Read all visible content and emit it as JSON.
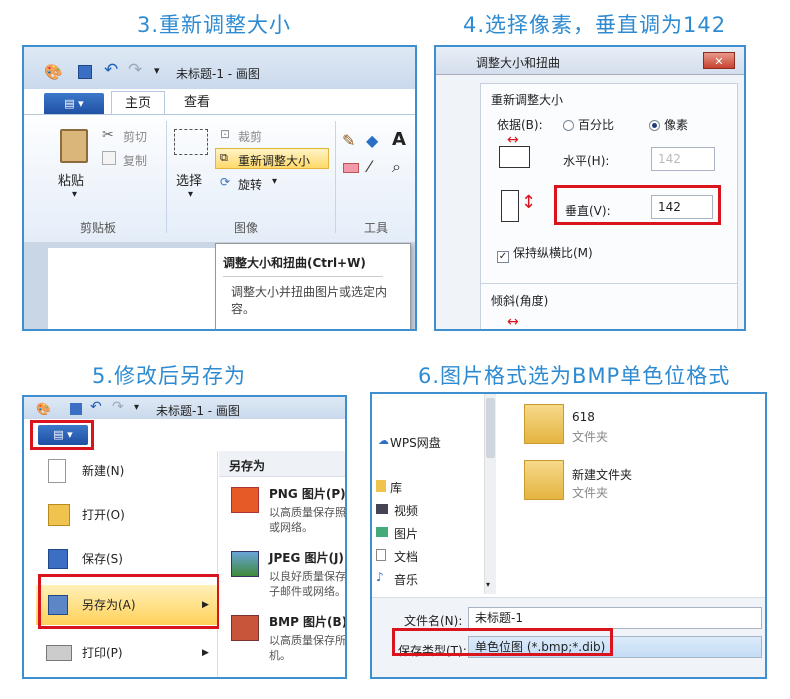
{
  "steps": {
    "s3": "3.重新调整大小",
    "s4": "4.选择像素，垂直调为142",
    "s5": "5.修改后另存为",
    "s6": "6.图片格式选为BMP单色位格式"
  },
  "paint": {
    "title": "未标题-1 - 画图",
    "tabs": [
      "主页",
      "查看"
    ],
    "clipboard": {
      "paste": "粘贴",
      "cut": "剪切",
      "copy": "复制",
      "group": "剪贴板"
    },
    "image": {
      "select": "选择",
      "crop": "裁剪",
      "resize": "重新调整大小",
      "rotate": "旋转",
      "group": "图像"
    },
    "tools_group": "工具",
    "tooltip_title": "调整大小和扭曲(Ctrl+W)",
    "tooltip_desc": "调整大小并扭曲图片或选定内容。"
  },
  "dialog": {
    "title": "调整大小和扭曲",
    "section_resize": "重新调整大小",
    "by_label": "依据(B):",
    "percent": "百分比",
    "pixels": "像素",
    "horizontal": "水平(H):",
    "horizontal_value": "142",
    "vertical": "垂直(V):",
    "vertical_value": "142",
    "keep_ratio": "保持纵横比(M)",
    "section_skew": "倾斜(角度)"
  },
  "filemenu": {
    "title": "未标题-1 - 画图",
    "items": [
      "新建(N)",
      "打开(O)",
      "保存(S)",
      "另存为(A)",
      "打印(P)"
    ],
    "saveas_header": "另存为",
    "formats": [
      {
        "title": "PNG 图片(P)",
        "desc1": "以高质量保存照",
        "desc2": "或网络。"
      },
      {
        "title": "JPEG 图片(J)",
        "desc1": "以良好质量保存",
        "desc2": "子邮件或网络。"
      },
      {
        "title": "BMP 图片(B)",
        "desc1": "以高质量保存所",
        "desc2": "机。"
      }
    ]
  },
  "savedlg": {
    "tree": [
      "WPS网盘",
      "库",
      "视频",
      "图片",
      "文档",
      "音乐"
    ],
    "folders": [
      {
        "name": "618",
        "type": "文件夹"
      },
      {
        "name": "新建文件夹",
        "type": "文件夹"
      }
    ],
    "filename_label": "文件名(N):",
    "filename_value": "未标题-1",
    "filetype_label": "保存类型(T):",
    "filetype_value": "单色位图 (*.bmp;*.dib)"
  },
  "colors": {
    "accent": "#2e8bd1",
    "highlight": "#d9141c",
    "border": "#3d8fd0"
  }
}
